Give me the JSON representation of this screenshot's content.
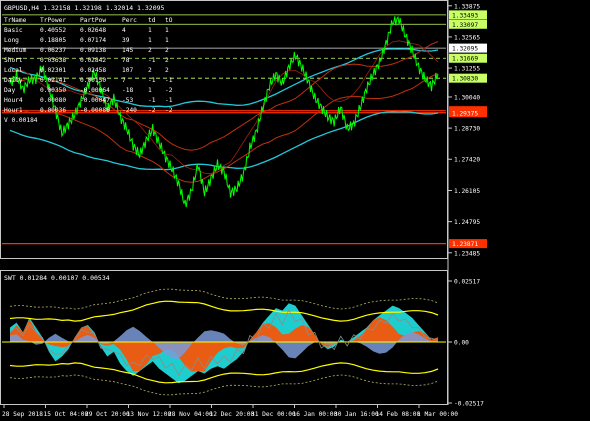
{
  "window": {
    "title": "GBPUSD,H4  1.32158 1.32198 1.32014 1.32095"
  },
  "colors": {
    "background": "#000000",
    "frame": "#c8c8c8",
    "grid": "#1a3a3a",
    "price": "#00ff00",
    "cyan": "#22c8d8",
    "resistance": "#ffff00",
    "dark_red": "#c03010",
    "red_line": "#ff3000",
    "orange": "#ff5a00",
    "steel_blue": "#6f8fc8",
    "swt_yellow": "#ffff00",
    "swt_cyan": "#20d8d8",
    "swt_orange": "#ff5000",
    "swt_blue": "#7a9ad8",
    "swt_gray": "#8c8c8c",
    "swt_khaki": "#b4b464"
  },
  "stats_table": {
    "headers": [
      "TrName",
      "TrPower",
      "PartPow",
      "Perc",
      "td",
      "tO"
    ],
    "rows": [
      [
        "Basic",
        "0.40552",
        "0.02648",
        "4",
        "1",
        "1"
      ],
      [
        "Long",
        "0.18805",
        "0.07174",
        "39",
        "1",
        "1"
      ],
      [
        "Medium",
        "0.06237",
        "0.09138",
        "145",
        "2",
        "2"
      ],
      [
        "Short",
        "0.03638",
        "0.02842",
        "78",
        "-1",
        "2"
      ],
      [
        "Local",
        "0.02301",
        "0.02458",
        "107",
        "2",
        "2"
      ],
      [
        "Daily",
        "0.02141",
        "0.00150",
        "7",
        "-1",
        "-1"
      ],
      [
        "Day",
        "0.00350",
        "-0.00064",
        "-18",
        "1",
        "-2"
      ],
      [
        "Hour4",
        "0.00080",
        "-0.00047",
        "-53",
        "-1",
        "-1"
      ],
      [
        "Hour1",
        "0.00036",
        "-0.00088",
        "-240",
        "-2",
        "-2"
      ]
    ],
    "footer": "V 0.00184"
  },
  "price_labels": [
    {
      "text": "1.33875",
      "kind": "scale"
    },
    {
      "text": "1.33493",
      "kind": "green"
    },
    {
      "text": "1.33097",
      "kind": "green"
    },
    {
      "text": "1.32095",
      "kind": "white"
    },
    {
      "text": "1.31669",
      "kind": "green"
    },
    {
      "text": "1.30830",
      "kind": "green"
    },
    {
      "text": "1.29463",
      "kind": "red"
    },
    {
      "text": "1.29375",
      "kind": "red"
    },
    {
      "text": "1.23871",
      "kind": "red"
    }
  ],
  "price_scale": [
    "1.33875",
    "1.32565",
    "1.31255",
    "1.30040",
    "1.28730",
    "1.27420",
    "1.26105",
    "1.24795",
    "1.23485"
  ],
  "sub_window": {
    "title": "SWT 0.01284 0.00107 0.00534",
    "scale": [
      "0.02517",
      "0.00",
      "-0.02517"
    ]
  },
  "time_axis": [
    "28 Sep 2018",
    "15 Oct 04:00",
    "29 Oct 20:00",
    "13 Nov 12:00",
    "28 Nov 04:00",
    "12 Dec 20:00",
    "31 Dec 00:00",
    "16 Jan 00:00",
    "30 Jan 16:00",
    "14 Feb 08:00",
    "1 Mar 00:00"
  ],
  "chart_data": [
    {
      "type": "line",
      "title": "GBPUSD,H4  1.32158 1.32198 1.32014 1.32095",
      "ylim": [
        1.2335,
        1.3395
      ],
      "x_ticks": [
        "28 Sep 2018",
        "15 Oct 04:00",
        "29 Oct 20:00",
        "13 Nov 12:00",
        "28 Nov 04:00",
        "12 Dec 20:00",
        "31 Dec 00:00",
        "16 Jan 00:00",
        "30 Jan 16:00",
        "14 Feb 08:00",
        "1 Mar 00:00"
      ],
      "series": [
        {
          "values": [
            1.306,
            1.3095,
            1.3035,
            1.3075,
            1.308,
            1.313,
            1.304,
            1.295,
            1.285,
            1.289,
            1.293,
            1.299,
            1.305,
            1.311,
            1.304,
            1.295,
            1.3,
            1.292,
            1.287,
            1.28,
            1.276,
            1.282,
            1.287,
            1.281,
            1.275,
            1.27,
            1.264,
            1.255,
            1.261,
            1.272,
            1.26,
            1.266,
            1.272,
            1.269,
            1.26,
            1.262,
            1.268,
            1.279,
            1.286,
            1.296,
            1.305,
            1.31,
            1.306,
            1.313,
            1.318,
            1.313,
            1.307,
            1.3,
            1.296,
            1.292,
            1.29,
            1.296,
            1.287,
            1.289,
            1.296,
            1.304,
            1.31,
            1.315,
            1.323,
            1.332,
            1.333,
            1.326,
            1.32,
            1.313,
            1.308,
            1.305,
            1.31
          ]
        }
      ]
    },
    {
      "type": "area",
      "title": "SWT 0.01284 0.00107 0.00534",
      "ylim": [
        -0.02517,
        0.02517
      ],
      "series": [
        {
          "name": "SWT",
          "values": [
            0.006,
            0.008,
            0.004,
            0.01,
            0.006,
            0.002,
            -0.004,
            -0.008,
            -0.006,
            -0.003,
            0.002,
            0.006,
            0.007,
            0.004,
            -0.002,
            -0.006,
            -0.004,
            -0.009,
            -0.012,
            -0.014,
            -0.012,
            -0.01,
            -0.008,
            -0.011,
            -0.013,
            -0.015,
            -0.017,
            -0.016,
            -0.014,
            -0.012,
            -0.013,
            -0.011,
            -0.01,
            -0.011,
            -0.009,
            -0.007,
            -0.004,
            0.001,
            0.004,
            0.008,
            0.011,
            0.014,
            0.013,
            0.016,
            0.015,
            0.011,
            0.007,
            0.003,
            -0.001,
            -0.003,
            -0.002,
            0.001,
            0.0,
            0.002,
            0.004,
            0.006,
            0.009,
            0.011,
            0.013,
            0.015,
            0.014,
            0.012,
            0.01,
            0.007,
            0.004,
            0.001,
            0.002
          ]
        }
      ]
    }
  ]
}
